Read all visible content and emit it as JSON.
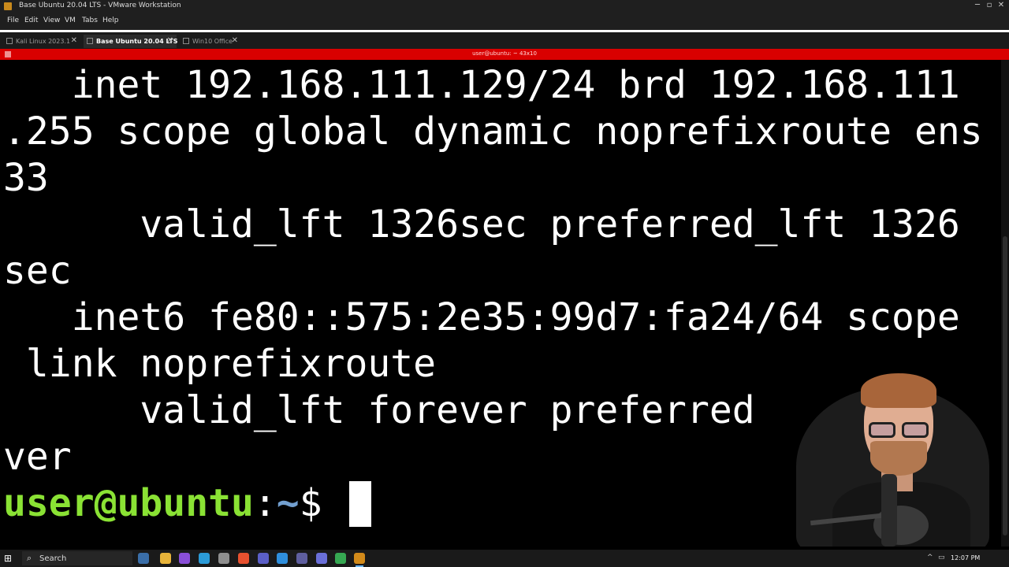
{
  "window": {
    "title": "Base Ubuntu 20.04 LTS - VMware Workstation",
    "minimize": "─",
    "maximize": "▫",
    "close": "✕"
  },
  "menu": [
    "File",
    "Edit",
    "View",
    "VM",
    "Tabs",
    "Help"
  ],
  "tabs": [
    {
      "label": "Kali Linux 2023.1",
      "active": false
    },
    {
      "label": "Base Ubuntu 20.04 LTS",
      "active": true
    },
    {
      "label": "Win10 Office",
      "active": false
    }
  ],
  "tab_close": "✕",
  "vm_titlebar": {
    "text": "user@ubuntu: ~ 43x10"
  },
  "terminal": {
    "lines": [
      "   inet 192.168.111.129/24 brd 192.168.111",
      ".255 scope global dynamic noprefixroute ens",
      "33",
      "      valid_lft 1326sec preferred_lft 1326",
      "sec",
      "   inet6 fe80::575:2e35:99d7:fa24/64 scope",
      " link noprefixroute",
      "      valid_lft forever preferred",
      "ver"
    ],
    "prompt": {
      "user_host": "user@ubuntu",
      "colon": ":",
      "path": "~",
      "dollar": "$ "
    }
  },
  "taskbar": {
    "start_icon": "⊞",
    "search_icon": "⌕",
    "search_label": "Search",
    "apps": [
      {
        "name": "task-view-icon",
        "color": "#3a6ea8"
      },
      {
        "name": "file-explorer-icon",
        "color": "#e8b43a"
      },
      {
        "name": "visual-studio-icon",
        "color": "#8a4fd8"
      },
      {
        "name": "network-icon",
        "color": "#2b9bd8"
      },
      {
        "name": "settings-icon",
        "color": "#8f8f8f"
      },
      {
        "name": "brave-icon",
        "color": "#e8512f"
      },
      {
        "name": "teams-icon",
        "color": "#5b5fc7"
      },
      {
        "name": "vscode-icon",
        "color": "#2f8fdd"
      },
      {
        "name": "obs-icon",
        "color": "#5f5f9f"
      },
      {
        "name": "discord-icon",
        "color": "#6a6fd8"
      },
      {
        "name": "chrome-icon",
        "color": "#36a852"
      },
      {
        "name": "vmware-icon",
        "color": "#d28a1a"
      }
    ],
    "clock": "12:07 PM"
  },
  "colors": {
    "vm_bar": "#d90000",
    "prompt_user": "#8ae234",
    "prompt_path": "#729fcf",
    "terminal_bg": "#000000",
    "terminal_fg": "#ffffff"
  }
}
